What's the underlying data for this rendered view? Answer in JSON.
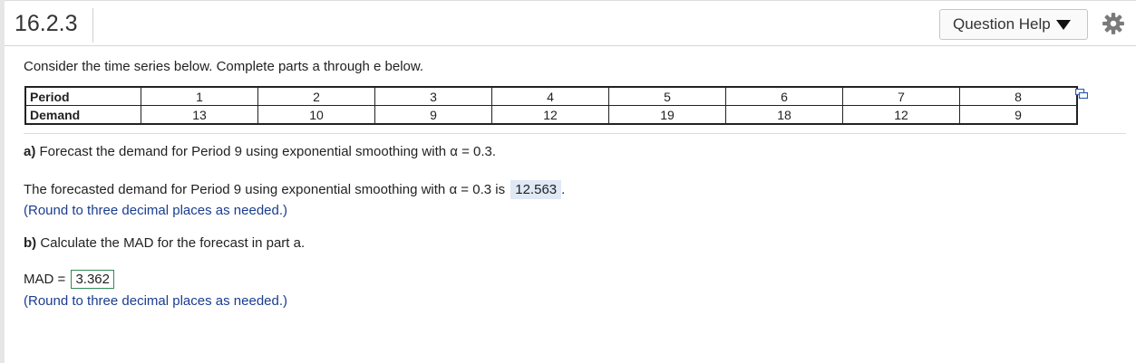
{
  "header": {
    "question_number": "16.2.3",
    "help_label": "Question Help"
  },
  "intro": "Consider the time series below. Complete parts a through e below.",
  "table": {
    "rows": [
      {
        "label": "Period",
        "values": [
          "1",
          "2",
          "3",
          "4",
          "5",
          "6",
          "7",
          "8"
        ]
      },
      {
        "label": "Demand",
        "values": [
          "13",
          "10",
          "9",
          "12",
          "19",
          "18",
          "12",
          "9"
        ]
      }
    ]
  },
  "part_a": {
    "prompt_label": "a)",
    "prompt_text": "Forecast the demand for Period 9 using exponential smoothing with",
    "alpha_symbol": "α",
    "alpha_value": "= 0.3.",
    "answer_prefix": "The forecasted demand for Period 9 using exponential smoothing with",
    "answer_alpha": "= 0.3 is",
    "answer_value": "12.563",
    "answer_suffix": ".",
    "hint": "(Round to three decimal places as needed.)"
  },
  "part_b": {
    "prompt_label": "b)",
    "prompt_text": "Calculate the MAD for the forecast in part a.",
    "mad_label": "MAD =",
    "mad_value": "3.362",
    "hint": "(Round to three decimal places as needed.)"
  },
  "colors": {
    "hint_blue": "#1a3d8f",
    "answer_bg": "#dfe8f5",
    "answer_border": "#2e8b57"
  }
}
